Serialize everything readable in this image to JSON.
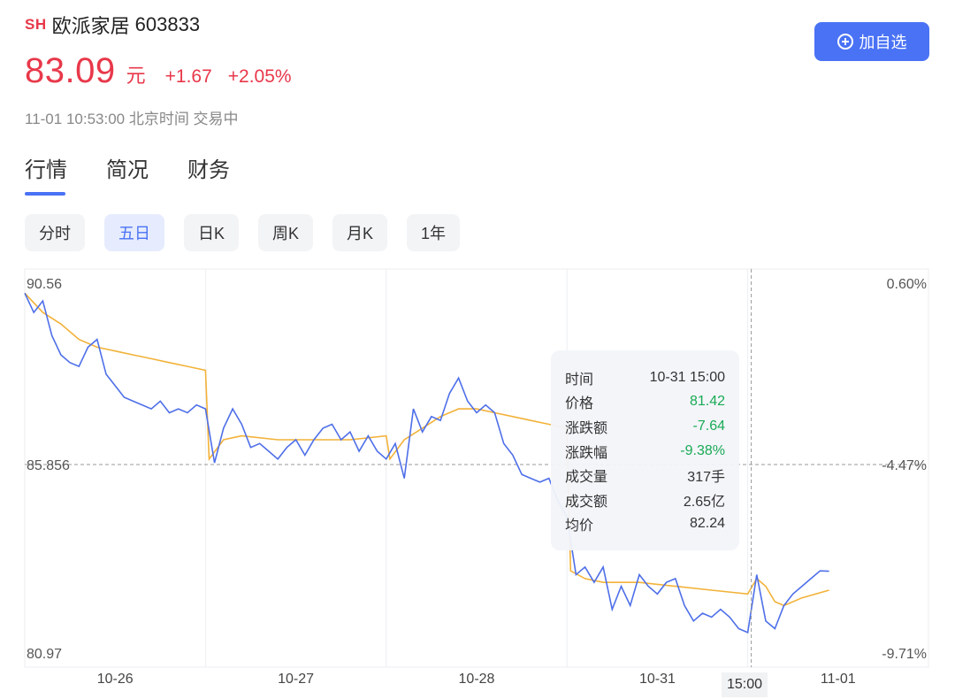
{
  "header": {
    "market": "SH",
    "name": "欧派家居",
    "code": "603833",
    "price": "83.09",
    "unit": "元",
    "change": "+1.67",
    "change_pct": "+2.05%",
    "status": "11-01 10:53:00 北京时间 交易中",
    "watch_label": "加自选"
  },
  "colors": {
    "up": "#e8384a",
    "down": "#1aaa55",
    "accent": "#4a72f5",
    "price_line": "#4e6fe8",
    "avg_line": "#f2b239"
  },
  "tabs": [
    {
      "label": "行情",
      "active": true
    },
    {
      "label": "简况",
      "active": false
    },
    {
      "label": "财务",
      "active": false
    }
  ],
  "periods": [
    {
      "label": "分时",
      "active": false
    },
    {
      "label": "五日",
      "active": true
    },
    {
      "label": "日K",
      "active": false
    },
    {
      "label": "周K",
      "active": false
    },
    {
      "label": "月K",
      "active": false
    },
    {
      "label": "1年",
      "active": false
    }
  ],
  "tooltip": {
    "time_label": "时间",
    "time_value": "10-31 15:00",
    "price_label": "价格",
    "price_value": "81.42",
    "chg_label": "涨跌额",
    "chg_value": "-7.64",
    "pct_label": "涨跌幅",
    "pct_value": "-9.38%",
    "vol_label": "成交量",
    "vol_value": "317手",
    "amt_label": "成交额",
    "amt_value": "2.65亿",
    "avg_label": "均价",
    "avg_value": "82.24"
  },
  "crosshair_time": "15:00",
  "chart_data": {
    "type": "line",
    "x_labels": [
      "10-26",
      "10-27",
      "10-28",
      "10-31",
      "11-01"
    ],
    "y_labels_left": [
      "90.56",
      "85.856",
      "80.97"
    ],
    "y_labels_right": [
      "0.60%",
      "-4.47%",
      "-9.71%"
    ],
    "ylim": [
      80.97,
      90.56
    ],
    "prev_close_line": 85.856,
    "grid": true,
    "series": [
      {
        "role": "price",
        "x": [
          0,
          0.05,
          0.1,
          0.15,
          0.2,
          0.25,
          0.3,
          0.35,
          0.4,
          0.45,
          0.5,
          0.55,
          0.6,
          0.65,
          0.7,
          0.75,
          0.8,
          0.85,
          0.9,
          0.95,
          1.0,
          1.05,
          1.1,
          1.15,
          1.2,
          1.25,
          1.3,
          1.35,
          1.4,
          1.45,
          1.5,
          1.55,
          1.6,
          1.65,
          1.7,
          1.75,
          1.8,
          1.85,
          1.9,
          1.95,
          2.0,
          2.05,
          2.1,
          2.15,
          2.2,
          2.25,
          2.3,
          2.35,
          2.4,
          2.45,
          2.5,
          2.55,
          2.6,
          2.65,
          2.7,
          2.75,
          2.8,
          2.85,
          2.9,
          2.95,
          3.0,
          3.05,
          3.1,
          3.15,
          3.2,
          3.25,
          3.3,
          3.35,
          3.4,
          3.45,
          3.5,
          3.55,
          3.6,
          3.65,
          3.7,
          3.75,
          3.8,
          3.85,
          3.9,
          3.95,
          4.0,
          4.05,
          4.1,
          4.15,
          4.2,
          4.25,
          4.3,
          4.35,
          4.4,
          4.45
        ],
        "values": [
          90.3,
          89.8,
          90.1,
          89.2,
          88.7,
          88.5,
          88.4,
          88.9,
          89.1,
          88.2,
          87.9,
          87.6,
          87.5,
          87.4,
          87.3,
          87.5,
          87.2,
          87.3,
          87.2,
          87.4,
          87.3,
          85.9,
          86.8,
          87.3,
          86.9,
          86.3,
          86.4,
          86.2,
          86.0,
          86.3,
          86.5,
          86.1,
          86.5,
          86.8,
          86.9,
          86.5,
          86.7,
          86.2,
          86.6,
          86.2,
          86.0,
          86.4,
          85.5,
          87.3,
          86.7,
          87.1,
          87.0,
          87.7,
          88.1,
          87.5,
          87.2,
          87.4,
          87.2,
          86.4,
          86.1,
          85.6,
          85.5,
          85.4,
          85.5,
          84.9,
          84.5,
          83.0,
          83.2,
          82.8,
          83.2,
          82.1,
          82.7,
          82.2,
          83.0,
          82.7,
          82.5,
          82.8,
          82.9,
          82.2,
          81.8,
          82.0,
          81.9,
          82.1,
          81.9,
          81.6,
          81.5,
          83.0,
          81.8,
          81.6,
          82.2,
          82.5,
          82.7,
          82.9,
          83.1,
          83.09
        ]
      },
      {
        "role": "average",
        "x": [
          0,
          0.1,
          0.2,
          0.3,
          0.4,
          0.5,
          0.6,
          0.7,
          0.8,
          0.9,
          1.0,
          1.02,
          1.1,
          1.2,
          1.4,
          1.6,
          1.8,
          2.0,
          2.02,
          2.1,
          2.2,
          2.3,
          2.4,
          2.5,
          2.6,
          2.7,
          2.8,
          2.9,
          3.0,
          3.02,
          3.1,
          3.2,
          3.4,
          3.6,
          3.8,
          4.0,
          4.05,
          4.1,
          4.15,
          4.2,
          4.3,
          4.45
        ],
        "values": [
          90.3,
          89.8,
          89.5,
          89.1,
          88.9,
          88.8,
          88.7,
          88.6,
          88.5,
          88.4,
          88.3,
          86.0,
          86.5,
          86.6,
          86.5,
          86.5,
          86.5,
          86.6,
          86.0,
          86.5,
          86.8,
          87.1,
          87.3,
          87.3,
          87.2,
          87.1,
          87.0,
          86.9,
          86.8,
          83.1,
          82.9,
          82.8,
          82.8,
          82.7,
          82.6,
          82.5,
          82.9,
          82.7,
          82.3,
          82.2,
          82.4,
          82.6
        ]
      }
    ]
  }
}
